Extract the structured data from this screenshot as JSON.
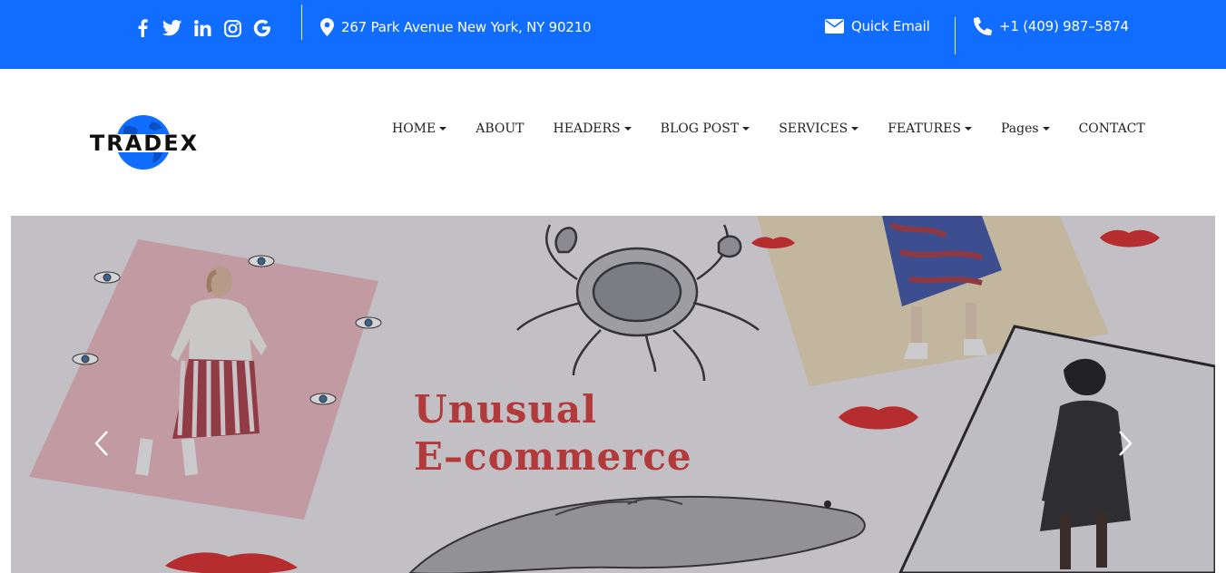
{
  "topbar": {
    "social": [
      {
        "name": "facebook-icon",
        "glyph": "f"
      },
      {
        "name": "twitter-icon",
        "glyph": "t"
      },
      {
        "name": "linkedin-icon",
        "glyph": "in"
      },
      {
        "name": "instagram-icon",
        "glyph": "ig"
      },
      {
        "name": "google-icon",
        "glyph": "G"
      }
    ],
    "address": "267 Park Avenue New York, NY 90210",
    "email_label": "Quick Email",
    "phone": "+1 (409) 987–5874",
    "bg_color": "#116dff"
  },
  "brand": {
    "name": "TRADEX",
    "globe_color": "#116dff"
  },
  "nav": {
    "items": [
      {
        "label": "HOME",
        "dropdown": true
      },
      {
        "label": "ABOUT",
        "dropdown": false
      },
      {
        "label": "HEADERS",
        "dropdown": true
      },
      {
        "label": "BLOG POST",
        "dropdown": true
      },
      {
        "label": "SERVICES",
        "dropdown": true
      },
      {
        "label": "FEATURES",
        "dropdown": true
      },
      {
        "label": "Pages",
        "dropdown": true
      },
      {
        "label": "CONTACT",
        "dropdown": false
      }
    ]
  },
  "hero": {
    "title_line1": "Unusual",
    "title_line2": "E–commerce",
    "prev_icon": "chevron-left-icon",
    "next_icon": "chevron-right-icon"
  }
}
